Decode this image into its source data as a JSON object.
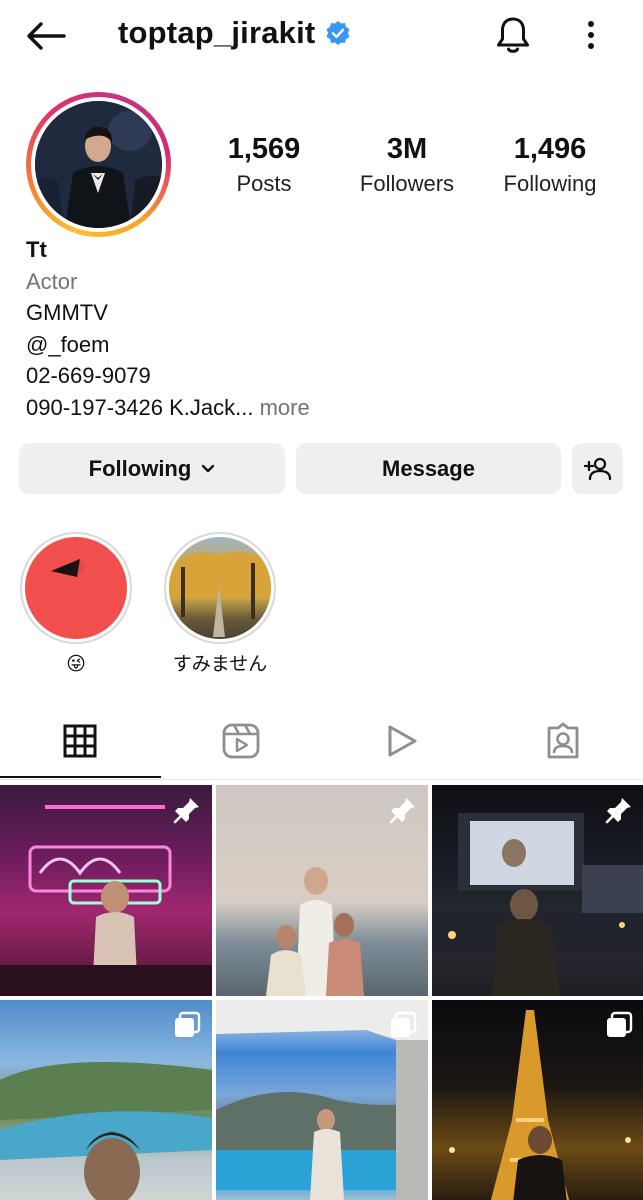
{
  "header": {
    "username": "toptap_jirakit",
    "icons": {
      "back": "arrow-left-icon",
      "verified": "verified-badge-icon",
      "notifications": "bell-icon",
      "more": "more-vertical-icon"
    }
  },
  "profile": {
    "stats": [
      {
        "value": "1,569",
        "label": "Posts"
      },
      {
        "value": "3M",
        "label": "Followers"
      },
      {
        "value": "1,496",
        "label": "Following"
      }
    ],
    "bio": {
      "name": "Tt",
      "category": "Actor",
      "lines": [
        "GMMTV",
        "@_foem",
        "02-669-9079"
      ],
      "last_line": "090-197-3426 K.Jack...",
      "more": " more"
    }
  },
  "actions": {
    "following_label": "Following",
    "message_label": "Message"
  },
  "highlights": [
    {
      "label": "😜"
    },
    {
      "label": "すみません"
    }
  ],
  "tabs": [
    "grid-icon",
    "reels-icon",
    "videos-icon",
    "tagged-icon"
  ],
  "colors": {
    "verified": "#3897f0",
    "ring_start": "#f9c02c",
    "ring_end": "#c13584",
    "button_bg": "#efefef",
    "muted_text": "#737373"
  },
  "posts": [
    {
      "badge": "pin-icon"
    },
    {
      "badge": "pin-icon"
    },
    {
      "badge": "pin-icon"
    },
    {
      "badge": "carousel-icon"
    },
    {
      "badge": "carousel-icon"
    },
    {
      "badge": "carousel-icon"
    }
  ]
}
